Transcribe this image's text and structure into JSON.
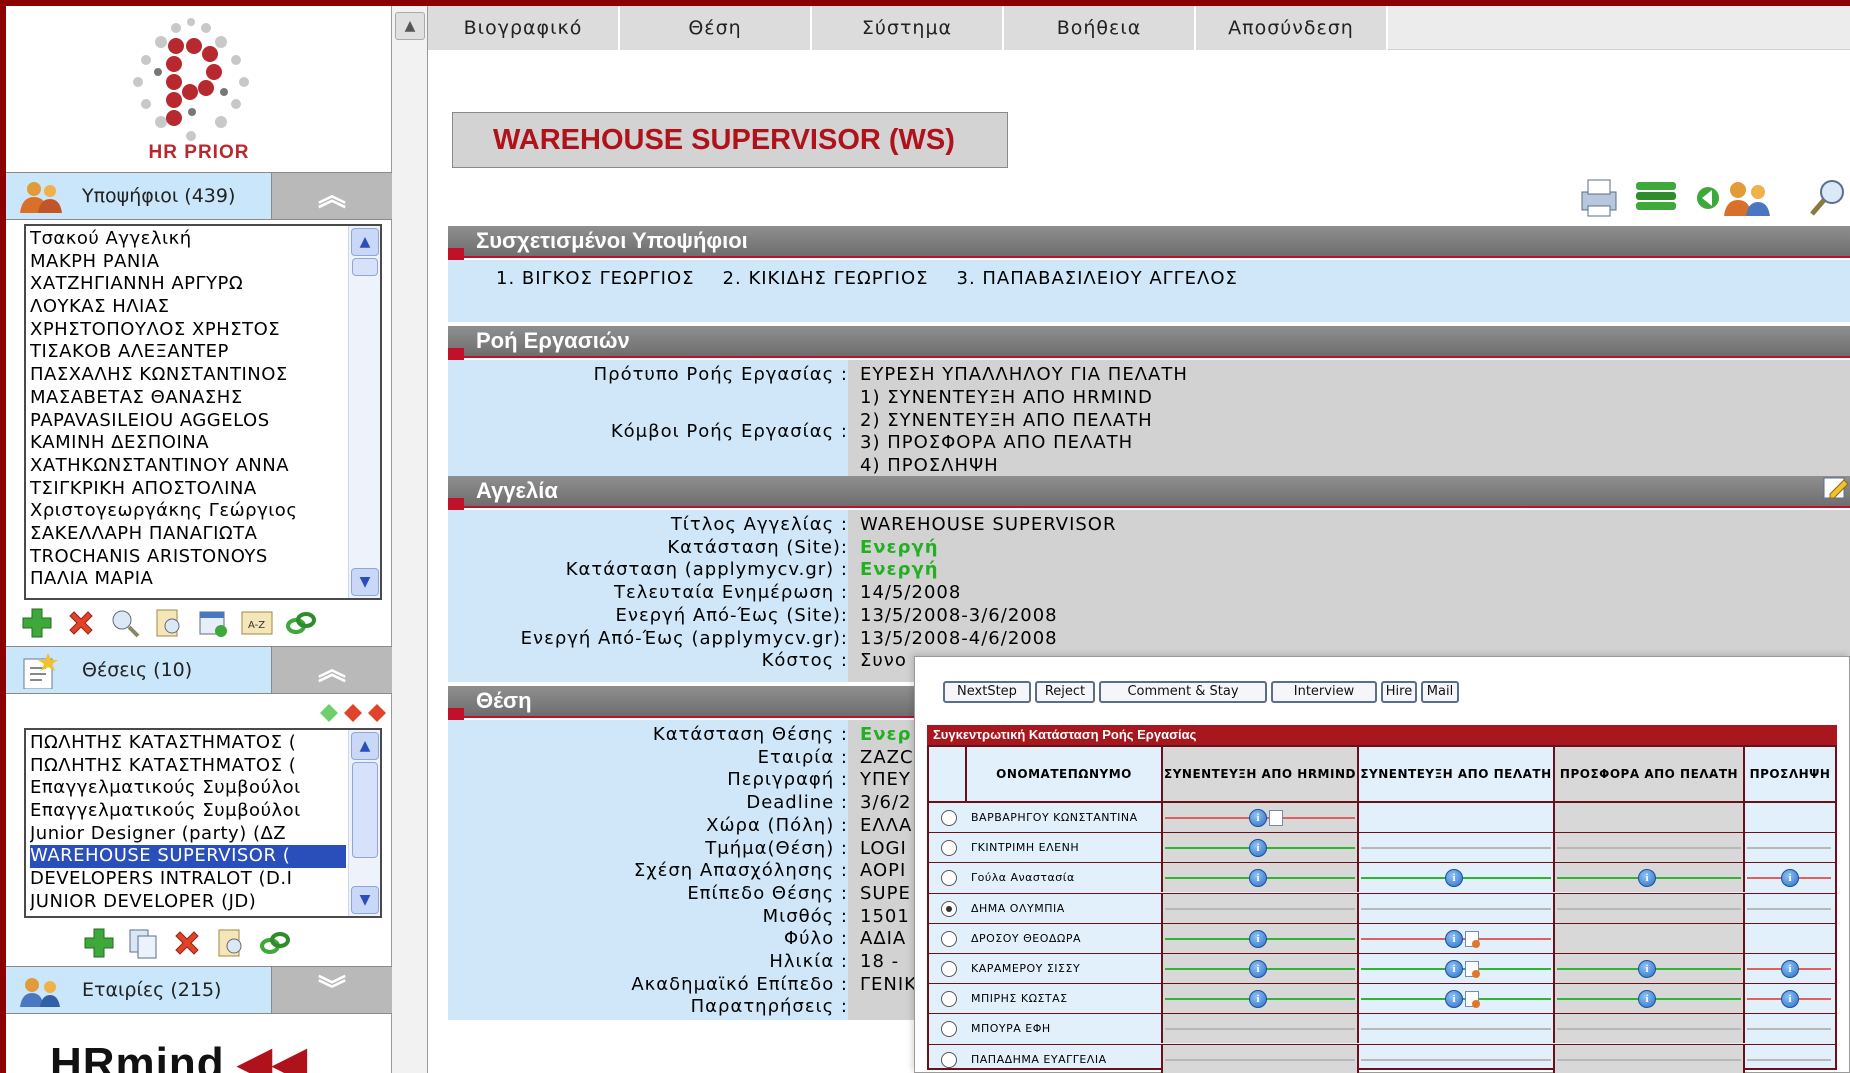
{
  "brand": {
    "logo_text": "HR PRIOR",
    "footer_logo": "HRmind",
    "accent": "#b0121b"
  },
  "sidebar": {
    "candidates": {
      "title": "Υποψήφιοι (439)",
      "items": [
        "Τσακού Αγγελική",
        "ΜΑΚΡΗ ΡΑΝΙΑ",
        "ΧΑΤΖΗΓΙΑΝΝΗ ΑΡΓΥΡΩ",
        "ΛΟΥΚΑΣ ΗΛΙΑΣ",
        "ΧΡΗΣΤΟΠΟΥΛΟΣ ΧΡΗΣΤΟΣ",
        "ΤΙΣΑΚΟΒ ΑΛΕΞΑΝΤΕΡ",
        "ΠΑΣΧΑΛΗΣ ΚΩΝΣΤΑΝΤΙΝΟΣ",
        "ΜΑΣΑΒΕΤΑΣ ΘΑΝΑΣΗΣ",
        "PAPAVASILEIOU AGGELOS",
        "ΚΑΜΙΝΗ ΔΕΣΠΟΙΝΑ",
        "ΧΑΤΗΚΩΝΣΤΑΝΤΙΝΟΥ ΑΝΝΑ",
        "ΤΣΙΓΚΡΙΚΗ ΑΠΟΣΤΟΛΙΝΑ",
        "Χριστογεωργάκης Γεώργιος",
        "ΣΑΚΕΛΛΑΡΗ ΠΑΝΑΓΙΩΤΑ",
        "TROCHANIS ARISTONOYS",
        "ΠΑΛΙΑ ΜΑΡΙΑ"
      ]
    },
    "positions": {
      "title": "Θέσεις (10)",
      "items": [
        "ΠΩΛΗΤΗΣ ΚΑΤΑΣΤΗΜΑΤΟΣ (",
        "ΠΩΛΗΤΗΣ ΚΑΤΑΣΤΗΜΑΤΟΣ (",
        "Επαγγελματικούς Συμβούλοι",
        "Επαγγελματικούς Συμβούλοι",
        "Junior Designer (party) (ΔΖ",
        "WAREHOUSE SUPERVISOR (",
        "DEVELOPERS INTRALOT (D.I",
        "JUNIOR DEVELOPER (JD)"
      ],
      "selected_index": 5
    },
    "companies": {
      "title": "Εταιρίες (215)"
    }
  },
  "menu": [
    "Βιογραφικό",
    "Θέση",
    "Σύστημα",
    "Βοήθεια",
    "Αποσύνδεση"
  ],
  "page_title": "WAREHOUSE SUPERVISOR (WS)",
  "related": {
    "title": "Συσχετισμένοι Υποψήφιοι",
    "items": [
      "1.  ΒΙΓΚΟΣ ΓΕΩΡΓΙΟΣ",
      "2.  ΚΙΚΙΔΗΣ ΓΕΩΡΓΙΟΣ",
      "3.  ΠΑΠΑΒΑΣΙΛΕΙΟΥ ΑΓΓΕΛΟΣ"
    ]
  },
  "workflow": {
    "title": "Ροή Εργασιών",
    "template_label": "Πρότυπο Ροής Εργασίας :",
    "template_value": "ΕΥΡΕΣΗ ΥΠΑΛΛΗΛΟΥ ΓΙΑ ΠΕΛΑΤΗ",
    "nodes_label": "Κόμβοι Ροής Εργασίας :",
    "nodes": [
      "1) ΣΥΝΕΝΤΕΥΞΗ ΑΠΟ HRMIND",
      "2) ΣΥΝΕΝΤΕΥΞΗ ΑΠΟ ΠΕΛΑΤΗ",
      "3) ΠΡΟΣΦΟΡΑ ΑΠΟ ΠΕΛΑΤΗ",
      "4) ΠΡΟΣΛΗΨΗ"
    ]
  },
  "ad": {
    "title": "Αγγελία",
    "rows": [
      {
        "k": "Τίτλος Αγγελίας :",
        "v": "WAREHOUSE SUPERVISOR"
      },
      {
        "k": "Κατάσταση (Site):",
        "v": "Ενεργή"
      },
      {
        "k": "Κατάσταση (applymycv.gr) :",
        "v": "Ενεργή"
      },
      {
        "k": "Τελευταία Ενημέρωση :",
        "v": "14/5/2008"
      },
      {
        "k": "Ενεργή Από-Έως (Site):",
        "v": "13/5/2008-3/6/2008"
      },
      {
        "k": "Ενεργή Από-Έως (applymycv.gr):",
        "v": "13/5/2008-4/6/2008"
      },
      {
        "k": "Κόστος :",
        "v": "Συνο"
      }
    ]
  },
  "position": {
    "title": "Θέση",
    "rows": [
      {
        "k": "Κατάσταση Θέσης :",
        "v": "Ενερ"
      },
      {
        "k": "Εταιρία :",
        "v": "ZAZC"
      },
      {
        "k": "Περιγραφή :",
        "v": "ΥΠΕΥ"
      },
      {
        "k": "Deadline :",
        "v": "3/6/2"
      },
      {
        "k": "Χώρα (Πόλη) :",
        "v": "ΕΛΛΑ"
      },
      {
        "k": "Τμήμα(Θέση) :",
        "v": "LOGI"
      },
      {
        "k": "Σχέση Απασχόλησης :",
        "v": "AOPI"
      },
      {
        "k": "Επίπεδο Θέσης :",
        "v": "SUPE"
      },
      {
        "k": "Μισθός :",
        "v": "1501"
      },
      {
        "k": "Φύλο :",
        "v": "ΑΔΙΑ"
      },
      {
        "k": "Ηλικία :",
        "v": "18 -"
      },
      {
        "k": "Ακαδημαϊκό Επίπεδο :",
        "v": "ΓΕΝΙΚ"
      },
      {
        "k": "Παρατηρήσεις :",
        "v": ""
      }
    ]
  },
  "popup": {
    "buttons": [
      "NextStep",
      "Reject",
      "Comment & Stay",
      "Interview",
      "Hire",
      "Mail"
    ],
    "table_title": "Συγκεντρωτική Κατάσταση Ροής Εργασίας",
    "columns": [
      "ΟΝΟΜΑΤΕΠΩΝΥΜΟ",
      "ΣΥΝΕΝΤΕΥΞΗ ΑΠΟ HRMIND",
      "ΣΥΝΕΝΤΕΥΞΗ ΑΠΟ ΠΕΛΑΤΗ",
      "ΠΡΟΣΦΟΡΑ ΑΠΟ ΠΕΛΑΤΗ",
      "ΠΡΟΣΛΗΨΗ"
    ],
    "rows": [
      {
        "name": "ΒΑΡΒΑΡΗΓΟΥ ΚΩΝΣΤΑΝΤΙΝΑ",
        "selected": false
      },
      {
        "name": "ΓΚΙΝΤΡΙΜΗ ΕΛΕΝΗ",
        "selected": false
      },
      {
        "name": "Γούλα Αναστασία",
        "selected": false
      },
      {
        "name": "ΔΗΜΑ ΟΛΥΜΠΙΑ",
        "selected": true
      },
      {
        "name": "ΔΡΟΣΟΥ ΘΕΟΔΩΡΑ",
        "selected": false
      },
      {
        "name": "ΚΑΡΑΜΕΡΟΥ ΣΙΣΣΥ",
        "selected": false
      },
      {
        "name": "ΜΠΙΡΗΣ ΚΩΣΤΑΣ",
        "selected": false
      },
      {
        "name": "ΜΠΟΥΡΑ ΕΦΗ",
        "selected": false
      },
      {
        "name": "ΠΑΠΑΔΗΜΑ ΕΥΑΓΓΕΛΙΑ",
        "selected": false
      }
    ]
  }
}
